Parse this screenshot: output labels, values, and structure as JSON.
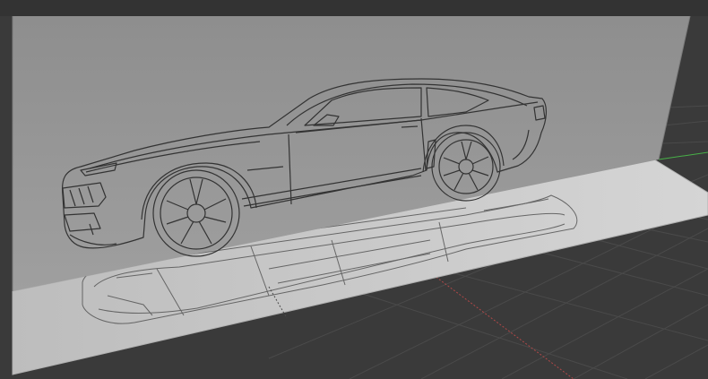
{
  "viewport": {
    "background_color": "#3a3a3a",
    "top_bar_color": "#333333",
    "grid_color": "#4a4a4a",
    "x_axis_color": "#b04848",
    "y_axis_color": "#48b048"
  },
  "reference_images": [
    {
      "name": "side-view",
      "content": "car-side-blueprint"
    },
    {
      "name": "top-view",
      "content": "car-top-blueprint"
    }
  ]
}
